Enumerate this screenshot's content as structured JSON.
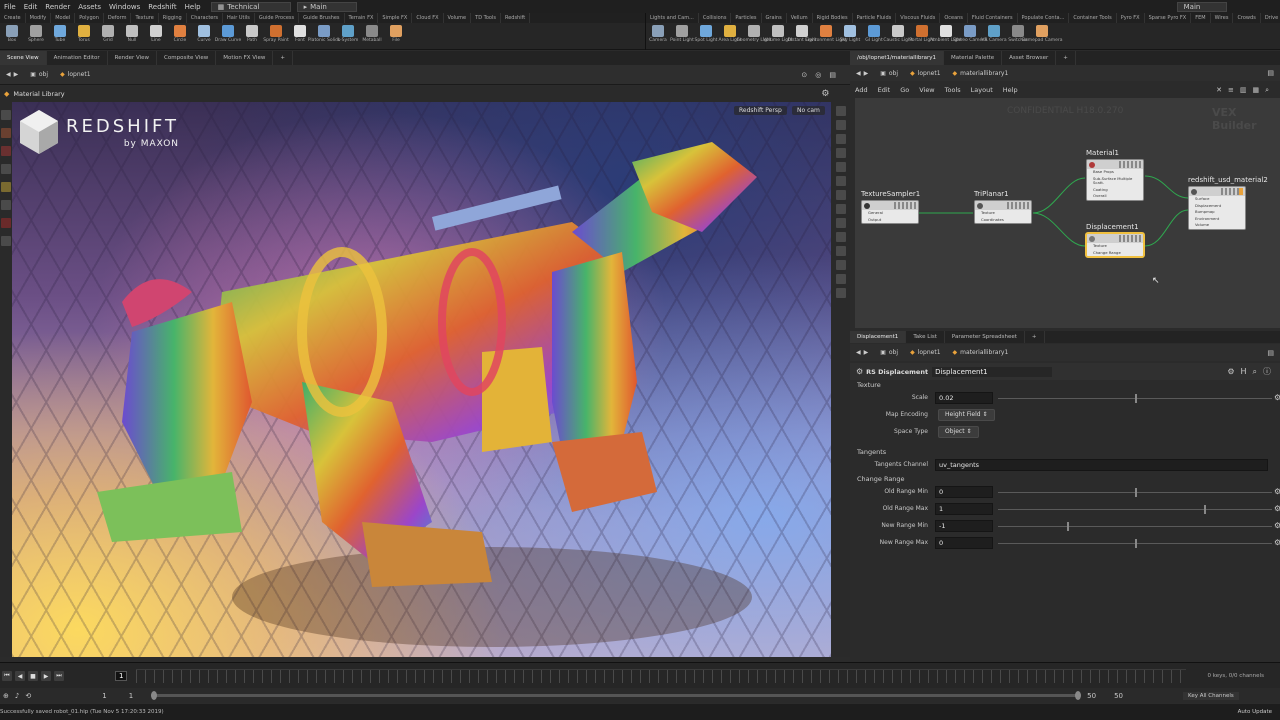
{
  "menubar": {
    "items": [
      "File",
      "Edit",
      "Render",
      "Assets",
      "Windows",
      "Redshift",
      "Help"
    ],
    "desktop": "Technical",
    "desktop_main": "Main",
    "right_main": "Main"
  },
  "shelf": {
    "left_tabs": [
      "Create",
      "Modify",
      "Model",
      "Polygon",
      "Deform",
      "Texture",
      "Rigging",
      "Characters",
      "Hair Utils",
      "Guide Process",
      "Guide Brushes",
      "Terrain FX",
      "Simple FX",
      "Cloud FX",
      "Volume",
      "TD Tools",
      "Redshift"
    ],
    "left_tools": [
      "Box",
      "Sphere",
      "Tube",
      "Torus",
      "Grid",
      "Null",
      "Line",
      "Circle",
      "Curve",
      "Draw Curve",
      "Path",
      "Spray Paint",
      "Font",
      "Platonic Solids",
      "L-System",
      "Metaball",
      "File"
    ],
    "right_tabs": [
      "Lights and Cam...",
      "Collisions",
      "Particles",
      "Grains",
      "Vellum",
      "Rigid Bodies",
      "Particle Fluids",
      "Viscous Fluids",
      "Oceans",
      "Fluid Containers",
      "Populate Conta...",
      "Container Tools",
      "Pyro FX",
      "Sparse Pyro FX",
      "FEM",
      "Wires",
      "Crowds",
      "Drive Simulation"
    ],
    "right_tools": [
      "Camera",
      "Point Light",
      "Spot Light",
      "Area Light",
      "Geometry Light",
      "Volume Light",
      "Distant Light",
      "Environment Light",
      "Sky Light",
      "GI Light",
      "Caustic Light",
      "Portal Light",
      "Ambient Light",
      "Stereo Camera",
      "VR Camera",
      "Switcher",
      "Gamepad Camera"
    ]
  },
  "left_pane": {
    "tabs": [
      "Scene View",
      "Animation Editor",
      "Render View",
      "Composite View",
      "Motion FX View"
    ],
    "path_obj": "obj",
    "path_node": "lopnet1",
    "viewport_title": "Material Library",
    "camera_label": "Redshift Persp",
    "cam_label": "No cam",
    "logo_brand": "REDSHIFT",
    "logo_by": "by MAXON"
  },
  "network": {
    "tabs": [
      "/obj/lopnet1/materiallibrary1",
      "Material Palette",
      "Asset Browser"
    ],
    "path_obj": "obj",
    "path_node1": "lopnet1",
    "path_node2": "materiallibrary1",
    "menu": [
      "Add",
      "Edit",
      "Go",
      "View",
      "Tools",
      "Layout",
      "Help"
    ],
    "watermark_confidential": "CONFIDENTIAL H18.0.270",
    "watermark_vex": "VEX Builder",
    "nodes": [
      {
        "name": "TextureSampler1",
        "io": [
          "General",
          "Output"
        ]
      },
      {
        "name": "TriPlanar1",
        "io": [
          "Texture",
          "Coordinates"
        ]
      },
      {
        "name": "Material1",
        "io": [
          "Base Props",
          "Sub-Surface Multiple Scatt.",
          "Coating",
          "Overall"
        ]
      },
      {
        "name": "Displacement1",
        "io": [
          "Texture",
          "Change Range"
        ]
      },
      {
        "name": "redshift_usd_material2",
        "io": [
          "Surface",
          "Displacement",
          "Bumpmap",
          "Environment",
          "Volume"
        ]
      }
    ]
  },
  "params": {
    "tabs": [
      "Displacement1",
      "Take List",
      "Parameter Spreadsheet"
    ],
    "path_obj": "obj",
    "path_node1": "lopnet1",
    "path_node2": "materiallibrary1",
    "node_type": "RS Displacement",
    "node_name": "Displacement1",
    "section_texture": "Texture",
    "scale_label": "Scale",
    "scale_value": "0.02",
    "scale_fraction": 0.5,
    "map_encoding_label": "Map Encoding",
    "map_encoding_value": "Height Field",
    "space_type_label": "Space Type",
    "space_type_value": "Object",
    "section_tangents": "Tangents",
    "tangents_label": "Tangents Channel",
    "tangents_value": "uv_tangents",
    "section_range": "Change Range",
    "old_min_label": "Old Range Min",
    "old_min_value": "0",
    "old_min_fraction": 0.5,
    "old_max_label": "Old Range Max",
    "old_max_value": "1",
    "old_max_fraction": 0.75,
    "new_min_label": "New Range Min",
    "new_min_value": "-1",
    "new_min_fraction": 0.25,
    "new_max_label": "New Range Max",
    "new_max_value": "0",
    "new_max_fraction": 0.5
  },
  "timeline": {
    "current_frame": "1",
    "start_frame": "1",
    "start_frame2": "1",
    "end_frame": "50",
    "end_frame2": "50",
    "keys_info": "0 keys, 0/0 channels",
    "key_all": "Key All Channels"
  },
  "status": {
    "message": "Successfully saved robot_01.hip (Tue Nov 5 17:20:33 2019)",
    "auto_update": "Auto Update"
  }
}
